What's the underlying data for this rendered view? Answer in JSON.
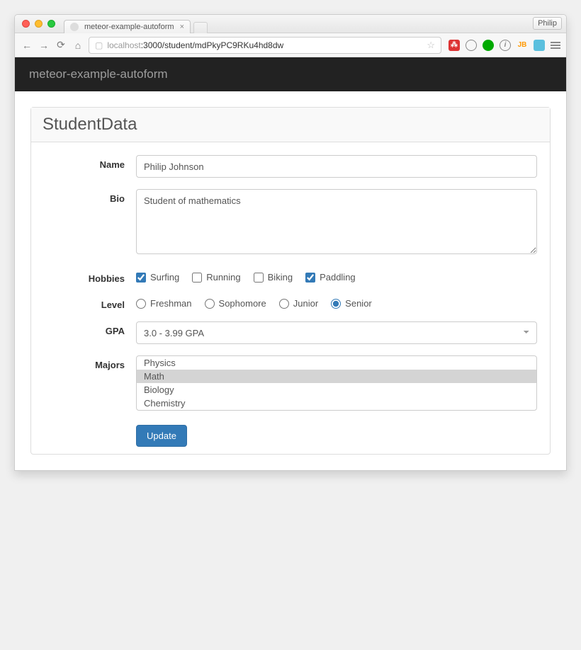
{
  "browser": {
    "tab_title": "meteor-example-autoform",
    "profile_name": "Philip",
    "url_host": "localhost",
    "url_path": ":3000/student/mdPkyPC9RKu4hd8dw"
  },
  "navbar": {
    "brand": "meteor-example-autoform"
  },
  "panel": {
    "title": "StudentData"
  },
  "form": {
    "name": {
      "label": "Name",
      "value": "Philip Johnson"
    },
    "bio": {
      "label": "Bio",
      "value": "Student of mathematics"
    },
    "hobbies": {
      "label": "Hobbies",
      "options": [
        {
          "label": "Surfing",
          "checked": true
        },
        {
          "label": "Running",
          "checked": false
        },
        {
          "label": "Biking",
          "checked": false
        },
        {
          "label": "Paddling",
          "checked": true
        }
      ]
    },
    "level": {
      "label": "Level",
      "options": [
        {
          "label": "Freshman",
          "checked": false
        },
        {
          "label": "Sophomore",
          "checked": false
        },
        {
          "label": "Junior",
          "checked": false
        },
        {
          "label": "Senior",
          "checked": true
        }
      ]
    },
    "gpa": {
      "label": "GPA",
      "value": "3.0 - 3.99 GPA"
    },
    "majors": {
      "label": "Majors",
      "options": [
        {
          "label": "Physics",
          "selected": false
        },
        {
          "label": "Math",
          "selected": true
        },
        {
          "label": "Biology",
          "selected": false
        },
        {
          "label": "Chemistry",
          "selected": false
        }
      ]
    },
    "submit_label": "Update"
  }
}
